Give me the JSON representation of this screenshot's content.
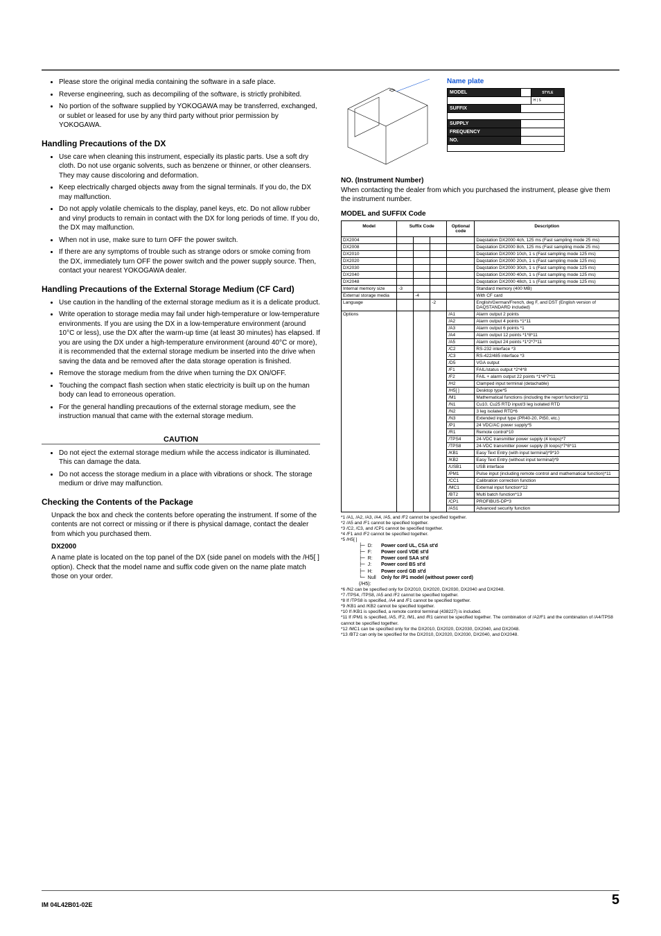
{
  "left": {
    "intro_bullets": [
      "Please store the original media containing the software in a safe place.",
      "Reverse engineering, such as decompiling of the software, is strictly prohibited.",
      "No portion of the software supplied by YOKOGAWA may be transferred, exchanged, or sublet or leased for use by any third party without prior permission by YOKOGAWA."
    ],
    "h_dx": "Handling Precautions of the DX",
    "dx_bullets": [
      "Use care when cleaning this instrument, especially its plastic parts. Use a soft dry cloth. Do not use organic solvents, such as benzene or thinner, or other cleansers. They may cause discoloring and deformation.",
      "Keep electrically charged objects away from the signal terminals. If you do, the DX may malfunction.",
      "Do not apply volatile chemicals to the display, panel keys, etc. Do not allow rubber and vinyl products to remain in contact with the DX for long periods of time. If you do, the DX may malfunction.",
      "When not in use, make sure to turn OFF the power switch.",
      "If there are any symptoms of trouble such as strange odors or smoke coming from the DX, immediately turn OFF the power switch and the power supply source. Then, contact your nearest YOKOGAWA dealer."
    ],
    "h_ext": "Handling Precautions of the External Storage Medium (CF Card)",
    "ext_bullets": [
      "Use caution in the handling of the external storage medium as it is a delicate product.",
      "Write operation to storage media may fail under high-temperature or low-temperature environments. If you are using the DX in a low-temperature environment (around 10°C or less), use the DX after the warm-up time (at least 30 minutes) has elapsed. If you are using the DX under a high-temperature environment (around 40°C or more), it is recommended that the external storage medium be inserted into the drive when saving the data and be removed after the data storage operation is finished.",
      "Remove the storage medium from the drive when turning the DX ON/OFF.",
      "Touching the compact flash section when static electricity is built up on the human body can lead to erroneous operation.",
      "For the general handling precautions of the external storage medium, see the instruction manual that came with the external storage medium."
    ],
    "caution_head": "CAUTION",
    "caution_bullets": [
      "Do not eject the external storage medium while the access indicator is illuminated. This can damage the data.",
      "Do not access the storage medium in a place with vibrations or shock. The storage medium or drive may malfunction."
    ],
    "h_pkg": "Checking the Contents of the Package",
    "pkg_para": "Unpack the box and check the contents before operating the instrument. If some of the contents are not correct or missing or if there is physical damage, contact the dealer from which you purchased them.",
    "dx2000_head": "DX2000",
    "dx2000_para": "A name plate is located on the top panel of the DX (side panel on models with the /H5[ ] option). Check that the model name and suffix code given on the name plate match those on your order."
  },
  "right": {
    "np_label": "Name plate",
    "np_rows": [
      "MODEL",
      "STYLE",
      "H",
      "S",
      "SUFFIX",
      "SUPPLY",
      "FREQUENCY",
      "NO."
    ],
    "no_head": "NO. (Instrument Number)",
    "no_para": "When contacting the dealer from which you purchased the instrument, please give them the instrument number.",
    "ms_head": "MODEL and SUFFIX Code",
    "th_model": "Model",
    "th_suffix": "Suffix Code",
    "th_opt": "Optional code",
    "th_desc": "Description",
    "models": [
      {
        "m": "DX2004",
        "d": "Daqstation DX2000 4ch, 125 ms (Fast sampling mode 25 ms)"
      },
      {
        "m": "DX2008",
        "d": "Daqstation DX2000 8ch, 125 ms (Fast sampling mode 25 ms)"
      },
      {
        "m": "DX2010",
        "d": "Daqstation DX2000 10ch, 1 s (Fast sampling mode 125 ms)"
      },
      {
        "m": "DX2020",
        "d": "Daqstation DX2000 20ch, 1 s (Fast sampling mode 125 ms)"
      },
      {
        "m": "DX2030",
        "d": "Daqstation DX2000 30ch, 1 s (Fast sampling mode 125 ms)"
      },
      {
        "m": "DX2040",
        "d": "Daqstation DX2000 40ch, 1 s (Fast sampling mode 125 ms)"
      },
      {
        "m": "DX2048",
        "d": "Daqstation DX2000 48ch, 1 s (Fast sampling mode 125 ms)"
      }
    ],
    "row_mem": {
      "label": "Internal memory size",
      "code": "-3",
      "desc": "Standard memory (400 MB)"
    },
    "row_ext": {
      "label": "External storage media",
      "code": "-4",
      "desc": "With CF card"
    },
    "row_lang": {
      "label": "Language",
      "code": "-2",
      "desc": "English/German/French, deg F, and DST (English version of DAQSTANDARD included)"
    },
    "opt_label": "Options",
    "options": [
      {
        "c": "/A1",
        "d": "Alarm output 2 points"
      },
      {
        "c": "/A2",
        "d": "Alarm output 4 points *1*11"
      },
      {
        "c": "/A3",
        "d": "Alarm output 6 points *1"
      },
      {
        "c": "/A4",
        "d": "Alarm output 12 points *1*8*11"
      },
      {
        "c": "/A5",
        "d": "Alarm output 24 points *1*2*7*11"
      },
      {
        "c": "/C2",
        "d": "RS-232 interface *3"
      },
      {
        "c": "/C3",
        "d": "RS-422/485 interface *3"
      },
      {
        "c": "/D5",
        "d": "VGA output"
      },
      {
        "c": "/F1",
        "d": "FAIL/status output *2*4*8"
      },
      {
        "c": "/F2",
        "d": "FAIL + alarm output 22 points *1*4*7*11"
      },
      {
        "c": "/H2",
        "d": "Clamped input terminal (detachable)"
      },
      {
        "c": "/H5[ ]",
        "d": "Desktop type*5"
      },
      {
        "c": "/M1",
        "d": "Mathematical functions (including the report function)*11"
      },
      {
        "c": "/N1",
        "d": "Cu10, Cu25 RTD input/3 leg isolated RTD"
      },
      {
        "c": "/N2",
        "d": "3 leg isolated RTD*6"
      },
      {
        "c": "/N3",
        "d": "Extended input type (PR40-20, Pt50, etc.)"
      },
      {
        "c": "/P1",
        "d": "24 VDC/AC power supply*5"
      },
      {
        "c": "/R1",
        "d": "Remote control*10"
      },
      {
        "c": "/TPS4",
        "d": "24-VDC transmitter power supply (4 loops)*7"
      },
      {
        "c": "/TPS8",
        "d": "24-VDC transmitter power supply (8 loops)*7*8*11"
      },
      {
        "c": "/KB1",
        "d": "Easy Text Entry (with input terminal)*9*10"
      },
      {
        "c": "/KB2",
        "d": "Easy Text Entry (without input terminal)*9"
      },
      {
        "c": "/USB1",
        "d": "USB interface"
      },
      {
        "c": "/PM1",
        "d": "Pulse input (including remote control and mathematical function)*11"
      },
      {
        "c": "/CC1",
        "d": "Calibration correction function"
      },
      {
        "c": "/MC1",
        "d": "External input function*12"
      },
      {
        "c": "/BT2",
        "d": "Multi batch function*13"
      },
      {
        "c": "/CP1",
        "d": "PROFIBUS-DP*3"
      },
      {
        "c": "/AS1",
        "d": "Advanced security function"
      }
    ],
    "footnotes_top": [
      "*1   /A1, /A2, /A3, /A4, /A5, and /F2 cannot be specified together.",
      "*2   /A5 and /F1 cannot be specified together.",
      "*3   /C2, /C3, and /CP1 cannot be specified together.",
      "*4   /F1 and /F2 cannot be specified together.",
      "*5   /H5[ ]"
    ],
    "power_cords": [
      {
        "k": "D:",
        "v": "Power cord UL, CSA st'd"
      },
      {
        "k": "F:",
        "v": "Power cord VDE st'd"
      },
      {
        "k": "R:",
        "v": "Power cord SAA st'd"
      },
      {
        "k": "J:",
        "v": "Power cord BS st'd"
      },
      {
        "k": "H:",
        "v": "Power cord GB st'd"
      },
      {
        "k": "Null (/H5):",
        "v": "Only for /P1 model (without power cord)"
      }
    ],
    "footnotes_bot": [
      "*6   /N2 can be specified only for DX2010, DX2020, DX2030, DX2040 and DX2048.",
      "*7   /TPS4, /TPS8, /A5 and /F2 cannot be specified together.",
      "*8   If /TPS8 is specified, /A4 and /F1 cannot be specified together.",
      "*9   /KB1 and /KB2 cannot be specified together.",
      "*10  If /KB1 is specified, a remote control terminal (438227) is included.",
      "*11  If /PM1 is specified, /A5, /F2, /M1, and /R1 cannot be specified together. The combination of /A2/F1 and the combination of /A4/TPS8 cannot be specified together.",
      "*12  /MC1 can be specified only for the DX2010, DX2020, DX2030, DX2040, and DX2048.",
      "*13  /BT2 can only be specified for the DX2010, DX2020, DX2030, DX2040, and DX2048."
    ]
  },
  "footer": {
    "doc": "IM 04L42B01-02E",
    "page": "5"
  }
}
